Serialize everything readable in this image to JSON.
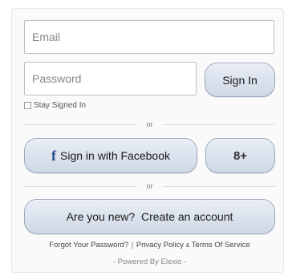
{
  "form": {
    "email_placeholder": "Email",
    "password_placeholder": "Password",
    "signin_label": "Sign In",
    "stay_signed_label": "Stay Signed In",
    "divider_or": "or",
    "facebook_label": "Sign in with Facebook",
    "facebook_icon": "f",
    "google_label": "8+",
    "create_label": "Are you new?  Create an account"
  },
  "footer": {
    "forgot": "Forgot Your Password?",
    "separator": "|",
    "privacy": "Privacy Policy",
    "amp": "&",
    "terms": "Terms Of Service",
    "powered": "- Powered By Elexio -"
  },
  "colors": {
    "button_border": "#9aa8bd",
    "facebook_blue": "#2a4b8d"
  }
}
